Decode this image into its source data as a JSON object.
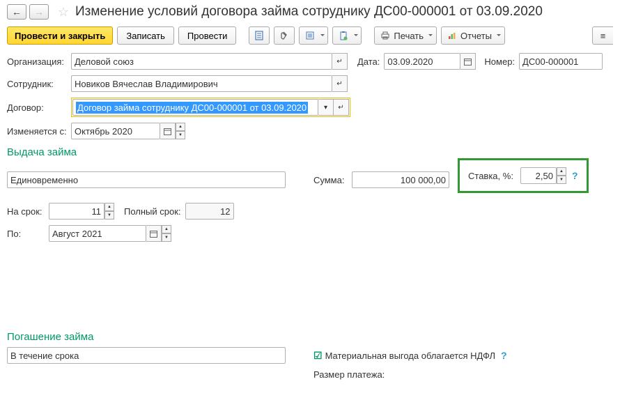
{
  "header": {
    "title": "Изменение условий договора займа сотруднику ДС00-000001 от 03.09.2020"
  },
  "toolbar": {
    "post_close": "Провести и закрыть",
    "write": "Записать",
    "post": "Провести",
    "print": "Печать",
    "reports": "Отчеты"
  },
  "form": {
    "org_label": "Организация:",
    "org_value": "Деловой союз",
    "date_label": "Дата:",
    "date_value": "03.09.2020",
    "num_label": "Номер:",
    "num_value": "ДС00-000001",
    "emp_label": "Сотрудник:",
    "emp_value": "Новиков Вячеслав Владимирович",
    "contract_label": "Договор:",
    "contract_value": "Договор займа сотруднику ДС00-000001 от 03.09.2020",
    "changes_label": "Изменяется с:",
    "changes_value": "Октябрь 2020"
  },
  "loan": {
    "title": "Выдача займа",
    "mode": "Единовременно",
    "sum_label": "Сумма:",
    "sum_value": "100 000,00",
    "rate_label": "Ставка, %:",
    "rate_value": "2,50",
    "term_label": "На срок:",
    "term_value": "11",
    "full_term_label": "Полный срок:",
    "full_term_value": "12",
    "until_label": "По:",
    "until_value": "Август 2021"
  },
  "repay": {
    "title": "Погашение займа",
    "mode": "В течение срока",
    "benefit": "Материальная выгода облагается НДФЛ",
    "payment_label": "Размер платежа:"
  }
}
